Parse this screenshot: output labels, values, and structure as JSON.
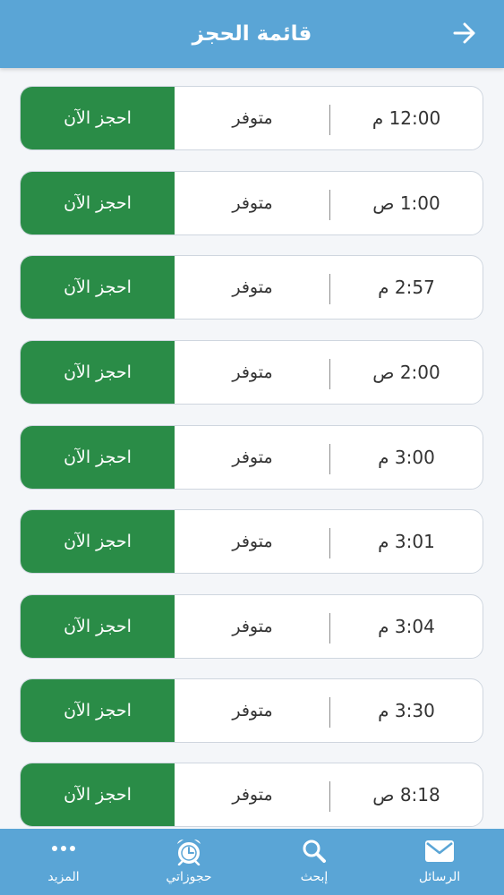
{
  "header": {
    "title": "قائمة الحجز",
    "back_icon": "arrow-right-icon",
    "color": "#5aa5d6"
  },
  "booking_list": [
    {
      "time": "12:00 م",
      "status": "متوفر",
      "action": "احجز الآن"
    },
    {
      "time": "1:00 ص",
      "status": "متوفر",
      "action": "احجز الآن"
    },
    {
      "time": "2:57 م",
      "status": "متوفر",
      "action": "احجز الآن"
    },
    {
      "time": "2:00 ص",
      "status": "متوفر",
      "action": "احجز الآن"
    },
    {
      "time": "3:00 م",
      "status": "متوفر",
      "action": "احجز الآن"
    },
    {
      "time": "3:01 م",
      "status": "متوفر",
      "action": "احجز الآن"
    },
    {
      "time": "3:04 م",
      "status": "متوفر",
      "action": "احجز الآن"
    },
    {
      "time": "3:30 م",
      "status": "متوفر",
      "action": "احجز الآن"
    },
    {
      "time": "8:18 ص",
      "status": "متوفر",
      "action": "احجز الآن"
    }
  ],
  "book_button_color": "#2a8c47",
  "bottom_nav": {
    "more": {
      "label": "المزيد",
      "icon": "more-dots-icon"
    },
    "bookings": {
      "label": "حجوزاتي",
      "icon": "alarm-clock-icon"
    },
    "search": {
      "label": "إبحث",
      "icon": "search-icon"
    },
    "messages": {
      "label": "الرسائل",
      "icon": "envelope-icon"
    }
  }
}
